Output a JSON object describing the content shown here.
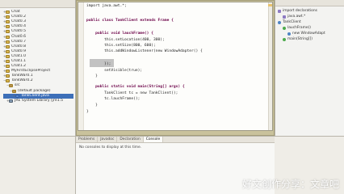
{
  "explorer": {
    "items": [
      "Chat",
      "Chat0.2",
      "Chat0.3",
      "Chat0.4",
      "Chat0.5",
      "Chat0.6",
      "Chat0.7",
      "Chat0.8",
      "Chat0.9",
      "Chat1.0",
      "Chat1.1",
      "Chat1.2",
      "MyFirstEclipseProject",
      "TankWar0.1",
      "TankWar0.2",
      "src",
      "(default package)",
      "TankClient.java",
      "JRE System Library [jre1.5"
    ]
  },
  "editor": {
    "lines": [
      "import java.awt.*;",
      "",
      "public class TankClient extends Frame {",
      "",
      "    public void lauchFrame() {",
      "        this.setLocation(400, 300);",
      "        this.setSize(800, 600);",
      "        this.addWindowListener(new WindowAdapter() {",
      "",
      "",
      "        });",
      "        setVisible(true);",
      "    }",
      "",
      "    public static void main(String[] args) {",
      "        TankClient tc = new TankClient();",
      "        tc.lauchFrame();",
      "    }",
      "}"
    ]
  },
  "outline": {
    "items": [
      "import declarations",
      "java.awt.*",
      "TankClient",
      "lauchFrame()",
      "new WindowAdapt",
      "main(String[])"
    ]
  },
  "console": {
    "tabs": [
      "Problems",
      "Javadoc",
      "Declaration",
      "Console"
    ],
    "message": "No consoles to display at this time."
  },
  "watermark": "好文创作分享：文章吧"
}
